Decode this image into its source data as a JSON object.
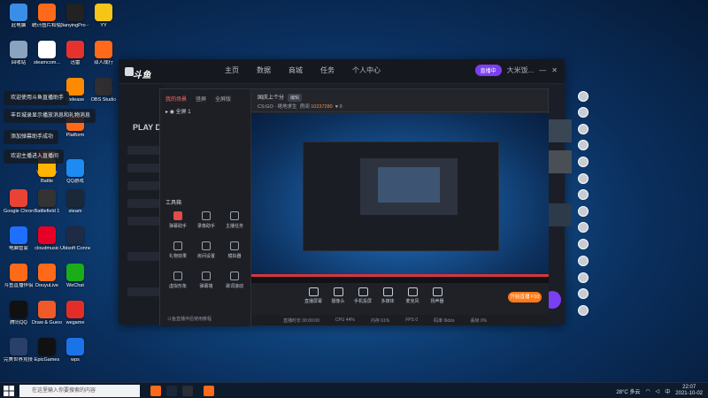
{
  "desktop_icons": [
    {
      "label": "此电脑",
      "color": "#3a8ee6"
    },
    {
      "label": "统计图片和使用客户端（无...",
      "color": "#ff6a1a"
    },
    {
      "label": "JianyingPro - 快捷方式",
      "color": "#222222"
    },
    {
      "label": "YY",
      "color": "#f5c518"
    },
    {
      "label": "回收站",
      "color": "#8aa4c0"
    },
    {
      "label": "steamcom...",
      "color": "#ffffff"
    },
    {
      "label": "迅雷",
      "color": "#e6322f"
    },
    {
      "label": "双人成行",
      "color": "#ff6a1a"
    },
    {
      "label": "Release",
      "color": "#ff8a00"
    },
    {
      "label": "OBS Studio",
      "color": "#302e31"
    },
    {
      "label": "Platform",
      "color": "#ff6a1a"
    },
    {
      "label": "WeGame",
      "color": "#ff6a1a"
    },
    {
      "label": "Battle",
      "color": "#ffb400"
    },
    {
      "label": "QQ游戏",
      "color": "#1d8bf1"
    },
    {
      "label": "Google Chrome",
      "color": "#ea4335"
    },
    {
      "label": "Battlefield 1",
      "color": "#333333"
    },
    {
      "label": "steam",
      "color": "#1b2838"
    },
    {
      "label": "电脑管家",
      "color": "#1e6fff"
    },
    {
      "label": "cloudmusic",
      "color": "#e60026"
    },
    {
      "label": "Ubisoft Connect",
      "color": "#1f2a44"
    },
    {
      "label": "斗鱼直播伴侣",
      "color": "#ff6a1a"
    },
    {
      "label": "DouyuLive",
      "color": "#ff6a1a"
    },
    {
      "label": "WeChat",
      "color": "#1aad19"
    },
    {
      "label": "腾讯QQ",
      "color": "#111111"
    },
    {
      "label": "Draw & Guess",
      "color": "#f05a28"
    },
    {
      "label": "wegame",
      "color": "#e52d27"
    },
    {
      "label": "完美世界竞技平台",
      "color": "#2a3f6a"
    },
    {
      "label": "EpicGames",
      "color": "#111111"
    },
    {
      "label": "wps",
      "color": "#1a73e8"
    }
  ],
  "notifications": [
    "欢迎使用斗鱼直播助手",
    "丰巨城录显示播放消息和礼物消息",
    "添加弹幕助手成功",
    "欢迎主播进入直播间"
  ],
  "app": {
    "logo": "斗鱼",
    "nav": [
      "主页",
      "数据",
      "商城",
      "任务",
      "个人中心"
    ],
    "live_badge": "直播中",
    "user": "大米饭...",
    "play_label": "PLAY D"
  },
  "obs": {
    "brand": "直播伴侣",
    "version": "测试版",
    "tabs": [
      "我的场景",
      "竖屏",
      "全屏版"
    ],
    "scene_name": "全屏 1",
    "tools_title": "工具箱",
    "tools": [
      "弹幕助手",
      "录像助手",
      "主播任务",
      "礼物效果",
      "房间设置",
      "模拟器",
      "虚拟形象",
      "弹幕墙",
      "歌词滚动"
    ],
    "bottom_tip": "斗鱼直播伴侣使用教程",
    "room_title": "国庆上个分",
    "room_tag": "编辑",
    "room_info": {
      "game": "CS:GO",
      "sub": "绝地求生",
      "room_label": "房间",
      "room_id": "10237280",
      "count": "0"
    },
    "controls": [
      "直播屏幕",
      "摄像头",
      "手机投屏",
      "多媒体",
      "麦克风",
      "扬声器"
    ],
    "start_live": "开始直播 F10",
    "status": [
      "直播时长 00:00:00",
      "CPU 44%",
      "内存 61%",
      "FPS 0",
      "码率 0kb/s",
      "丢帧 0%"
    ]
  },
  "taskbar": {
    "search_placeholder": "在这里输入你要搜索的内容",
    "weather": "28°C 多云",
    "time": "22:07",
    "date": "2021-10-02",
    "ime": "中"
  }
}
